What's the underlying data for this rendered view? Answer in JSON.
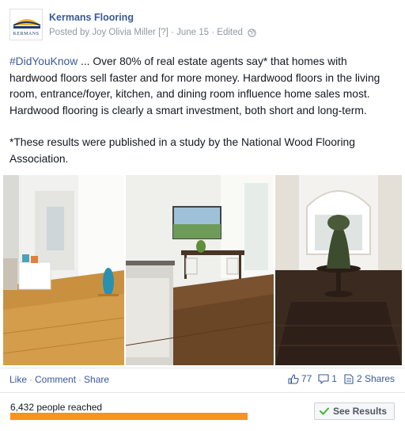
{
  "post": {
    "page_name": "Kermans Flooring",
    "logo_text": "KERMANS",
    "posted_by": "Posted by Joy Olivia Miller",
    "help_marker": "[?]",
    "date": "June 15",
    "edited": "Edited",
    "dot": "·",
    "hashtag": "#DidYouKnow",
    "body_text": " ... Over 80% of real estate agents say* that homes with hardwood floors sell faster and for more money. Hardwood floors in the living room, entrance/foyer, kitchen, and dining room influence home sales most. Hardwood flooring is clearly a smart investment, both short and long-term.",
    "footnote": "*These results were published in a study by the National Wood Flooring Association."
  },
  "icons": {
    "privacy": "globe-icon",
    "like_count": "thumbs-up-icon",
    "comment_count": "comment-icon",
    "share_count": "share-icon",
    "see_results": "check-icon"
  },
  "actions": {
    "like": "Like",
    "comment": "Comment",
    "share": "Share",
    "separator": "·"
  },
  "counts": {
    "likes": "77",
    "comments": "1",
    "shares": "2 Shares"
  },
  "insights": {
    "reach_label": "6,432 people reached",
    "reach_fraction": 1.0,
    "see_results_label": "See Results"
  },
  "colors": {
    "link": "#3b5998",
    "reach_bar": "#f7931e",
    "check": "#42b72a"
  }
}
